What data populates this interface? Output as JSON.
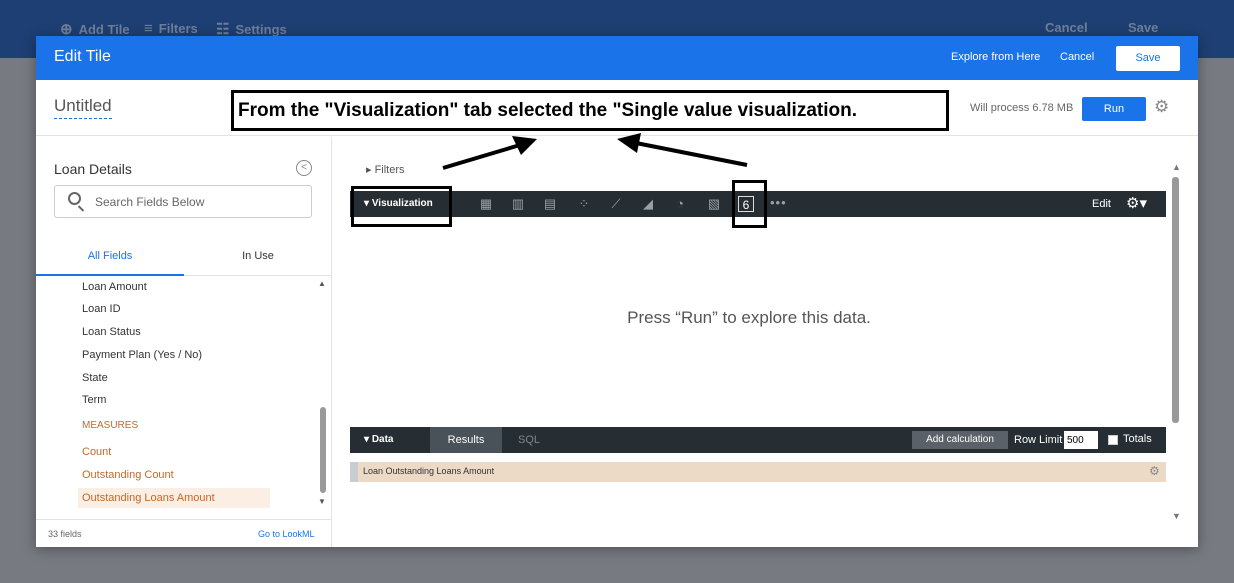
{
  "background": {
    "add_tile": "Add Tile",
    "filters": "Filters",
    "settings": "Settings",
    "cancel": "Cancel",
    "save": "Save"
  },
  "modal": {
    "title": "Edit Tile",
    "explore_link": "Explore from Here",
    "cancel": "Cancel",
    "save": "Save",
    "tile_title": "Untitled",
    "process_info": "Will process 6.78 MB",
    "run": "Run"
  },
  "field_picker": {
    "title": "Loan Details",
    "search_placeholder": "Search Fields Below",
    "tabs": [
      "All Fields",
      "In Use"
    ],
    "dimensions": [
      "Loan Amount",
      "Loan ID",
      "Loan Status",
      "Payment Plan (Yes / No)",
      "State",
      "Term"
    ],
    "measures_heading": "MEASURES",
    "measures": [
      "Count",
      "Outstanding Count",
      "Outstanding Loans Amount"
    ],
    "field_count": "33 fields",
    "lookml_link": "Go to LookML"
  },
  "explore": {
    "filters_label": "Filters",
    "visualization_label": "Visualization",
    "single_value_icon": "6",
    "edit": "Edit",
    "placeholder": "Press “Run” to explore this data.",
    "data_label": "Data",
    "results_tab": "Results",
    "sql_tab": "SQL",
    "add_calculation": "Add calculation",
    "row_limit_label": "Row Limit",
    "row_limit_value": "500",
    "totals_label": "Totals",
    "column_name": "Loan Outstanding Loans Amount"
  },
  "annotation": {
    "text": "From the \"Visualization\" tab selected the \"Single value visualization."
  },
  "colors": {
    "accent": "#1a73e8",
    "dark_bar": "#262d33",
    "measure": "#c2692b"
  }
}
